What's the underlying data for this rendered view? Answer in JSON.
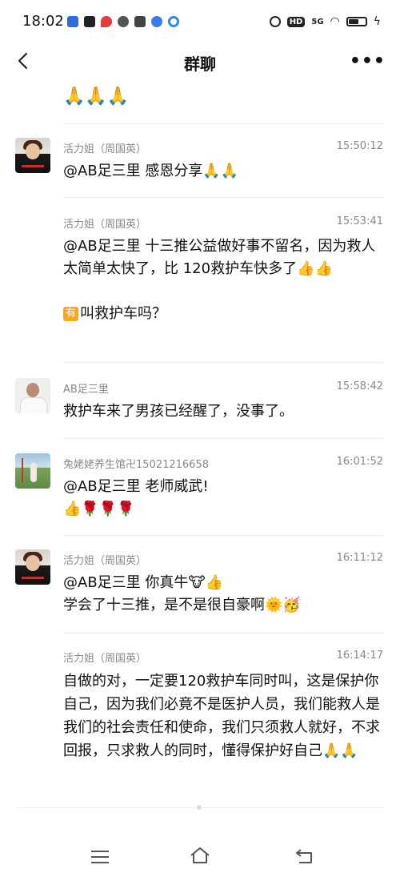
{
  "status_bar": {
    "time": "18:02",
    "left_icons": [
      "app-icon-1",
      "app-icon-2",
      "map-icon",
      "message-icon",
      "mail-icon",
      "paw-icon",
      "browser-icon"
    ],
    "hd": "HD",
    "network": "5G"
  },
  "header": {
    "title": "群聊",
    "more": "•••"
  },
  "top_fragment": {
    "emoji": "🙏🙏🙏"
  },
  "messages": [
    {
      "sender": "活力姐（周国英）",
      "time": "15:50:12",
      "avatar": "huoli",
      "lines": [
        "@AB足三里 感恩分享🙏🙏"
      ]
    },
    {
      "sender": "活力姐（周国英）",
      "time": "15:53:41",
      "avatar": "",
      "lines": [
        "@AB足三里 十三推公益做好事不留名，因为救人太简单太快了，比 120救护车快多了👍👍"
      ],
      "extra_tag": "有",
      "extra_text": "叫救护车吗？"
    },
    {
      "sender": "AB足三里",
      "time": "15:58:42",
      "avatar": "ab",
      "lines": [
        "救护车来了男孩已经醒了，没事了。"
      ]
    },
    {
      "sender": "兔姥姥养生馆卍15021216658",
      "time": "16:01:52",
      "avatar": "tu",
      "lines": [
        "@AB足三里 老师威武!",
        "👍🌹🌹🌹"
      ]
    },
    {
      "sender": "活力姐（周国英）",
      "time": "16:11:12",
      "avatar": "huoli",
      "lines": [
        "@AB足三里 你真牛🐮👍",
        "学会了十三推，是不是很自豪啊🌞🥳"
      ]
    },
    {
      "sender": "活力姐（周国英）",
      "time": "16:14:17",
      "avatar": "",
      "lines": [
        "自做的对，一定要120救护车同时叫，这是保护你自己，因为我们必竟不是医护人员，我们能救人是我们的社会责任和使命，我们只须救人就好，不求回报，只求救人的同时，懂得保护好自己🙏🙏"
      ]
    }
  ],
  "system_nav": {
    "items": [
      "menu-icon",
      "home-icon",
      "back-icon"
    ]
  },
  "colors": {
    "background": "#ffffff",
    "meta_text": "#888888",
    "divider": "#ececec"
  }
}
